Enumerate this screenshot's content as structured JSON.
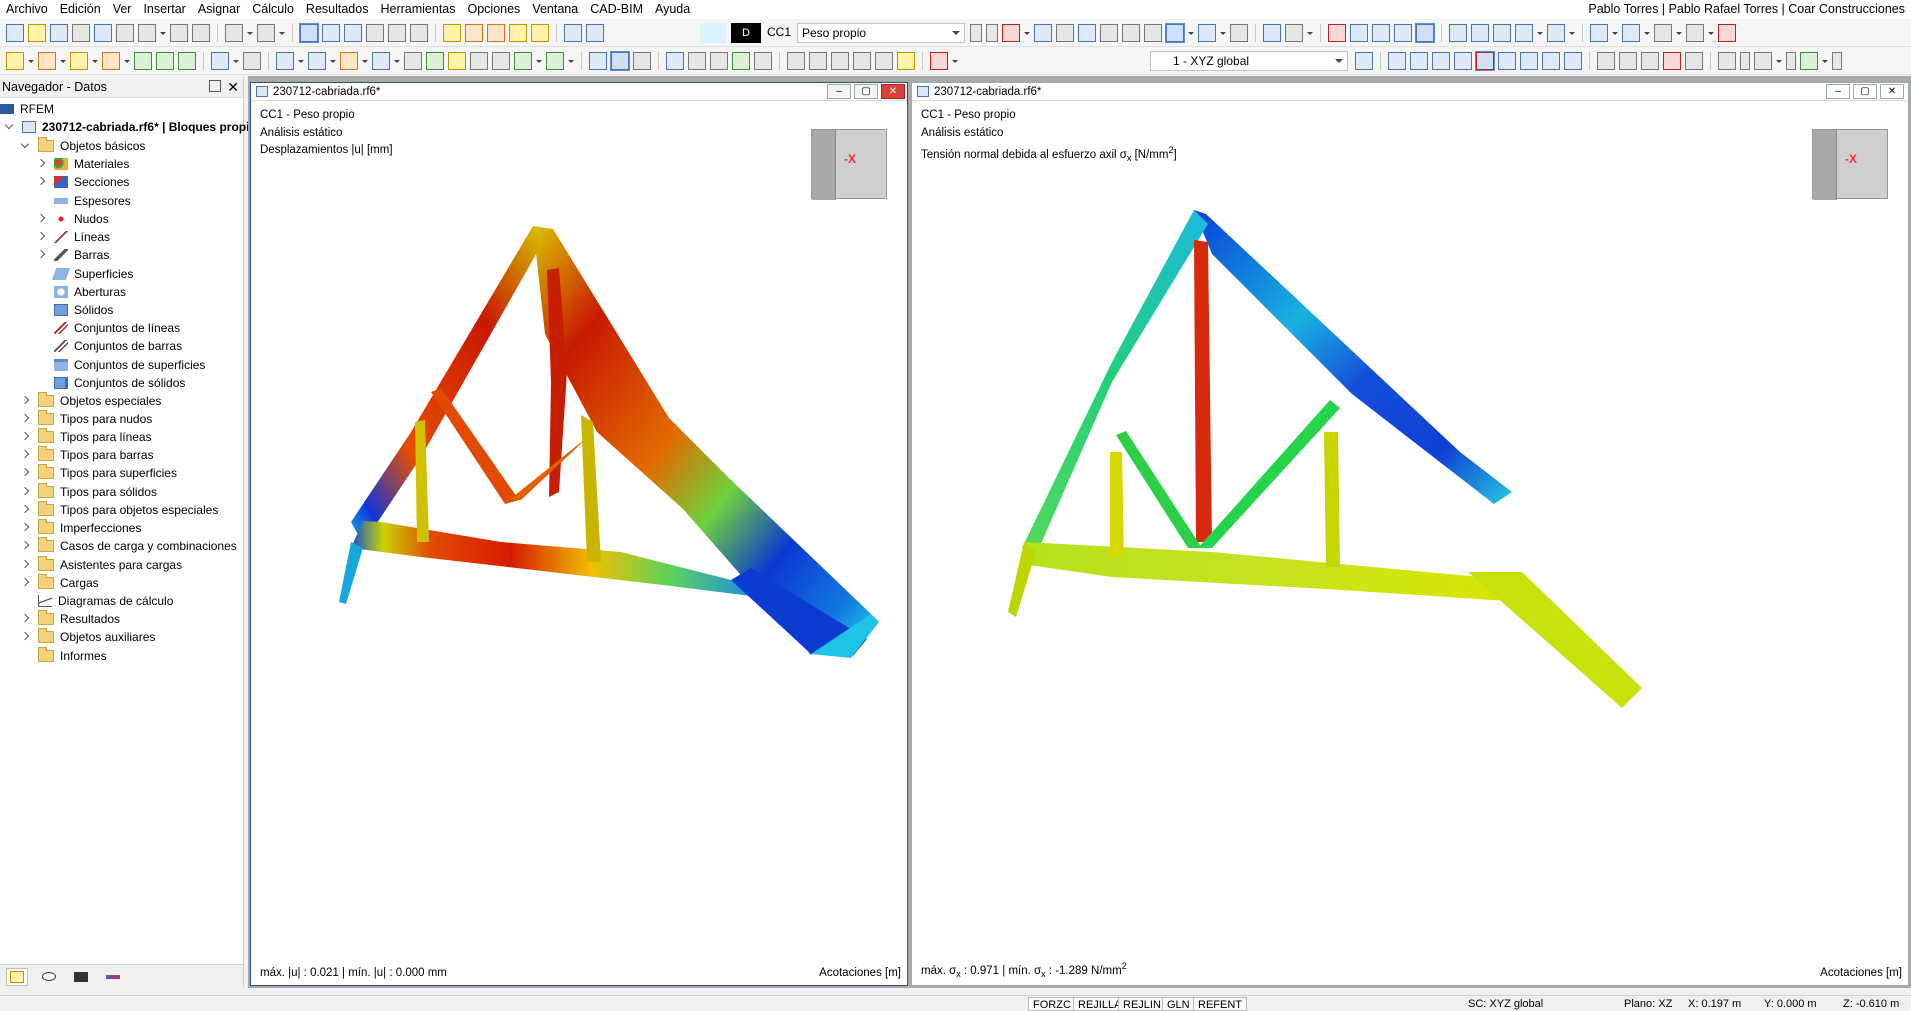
{
  "menu": [
    "Archivo",
    "Edición",
    "Ver",
    "Insertar",
    "Asignar",
    "Cálculo",
    "Resultados",
    "Herramientas",
    "Opciones",
    "Ventana",
    "CAD-BIM",
    "Ayuda"
  ],
  "user": "Pablo Torres | Pablo Rafael Torres | Coar Construcciones",
  "toolbar": {
    "load_case_tag": "D",
    "load_case_id": "CC1",
    "load_case_name": "Peso propio",
    "coordinate_system": "1 - XYZ global"
  },
  "navigator": {
    "title": "Navegador - Datos",
    "root": "RFEM",
    "model": "230712-cabriada.rf6* | Bloques propios",
    "basic_folder": "Objetos básicos",
    "basic_items": [
      "Materiales",
      "Secciones",
      "Espesores",
      "Nudos",
      "Líneas",
      "Barras",
      "Superficies",
      "Aberturas",
      "Sólidos",
      "Conjuntos de líneas",
      "Conjuntos de barras",
      "Conjuntos de superficies",
      "Conjuntos de sólidos"
    ],
    "folders": [
      "Objetos especiales",
      "Tipos para nudos",
      "Tipos para líneas",
      "Tipos para barras",
      "Tipos para superficies",
      "Tipos para sólidos",
      "Tipos para objetos especiales",
      "Imperfecciones",
      "Casos de carga y combinaciones",
      "Asistentes para cargas",
      "Cargas",
      "Diagramas de cálculo",
      "Resultados",
      "Objetos auxiliares",
      "Informes"
    ]
  },
  "window_left": {
    "title": "230712-cabriada.rf6*",
    "line1": "CC1 - Peso propio",
    "line2": "Análisis estático",
    "line3": "Desplazamientos |u| [mm]",
    "cube_label": "-X",
    "summary": "máx. |u| : 0.021 | mín. |u| : 0.000 mm",
    "dims": "Acotaciones [m]"
  },
  "window_right": {
    "title": "230712-cabriada.rf6*",
    "line1": "CC1 - Peso propio",
    "line2": "Análisis estático",
    "line3_prefix": "Tensión normal debida al esfuerzo axil σ",
    "line3_sub": "x",
    "line3_unit": " [N/mm",
    "line3_sup": "2",
    "line3_close": "]",
    "cube_label": "-X",
    "summary_a": "máx. σ",
    "summary_sub1": "x",
    "summary_b": " : 0.971 | mín. σ",
    "summary_sub2": "x",
    "summary_c": " : -1.289 N/mm",
    "summary_sup": "2",
    "dims": "Acotaciones [m]"
  },
  "status": {
    "buttons": [
      "FORZC",
      "REJILLA",
      "REJLIN",
      "GLN",
      "REFENT"
    ],
    "cs": "SC: XYZ global",
    "plane": "Plano: XZ",
    "x": "X: 0.197 m",
    "y": "Y: 0.000 m",
    "z": "Z: -0.610 m"
  }
}
